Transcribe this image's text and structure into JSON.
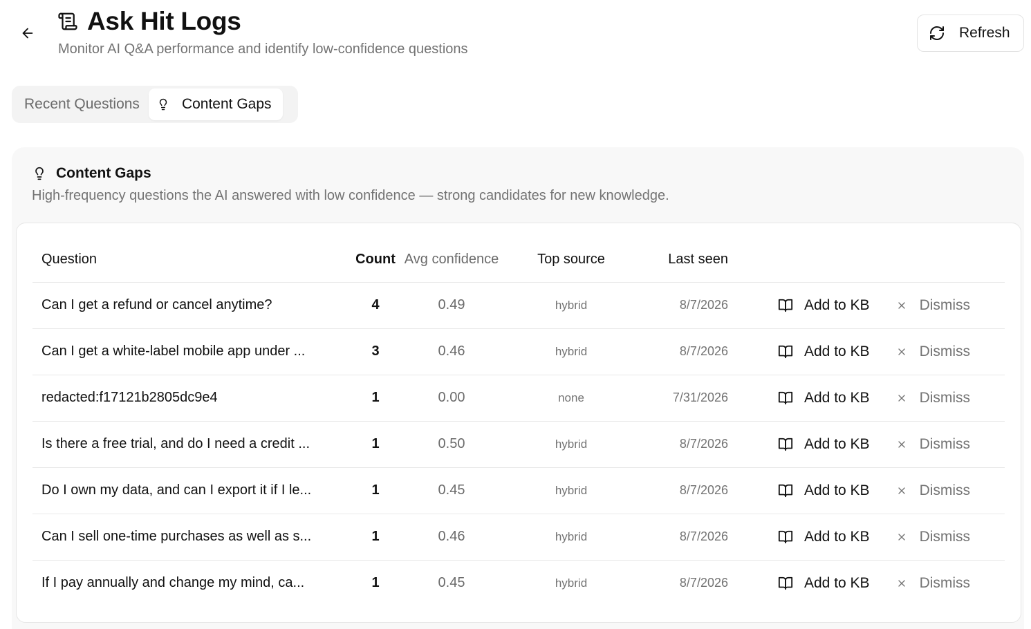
{
  "header": {
    "title": "Ask Hit Logs",
    "subtitle": "Monitor AI Q&A performance and identify low-confidence questions",
    "refresh_label": "Refresh"
  },
  "tabs": [
    {
      "label": "Recent Questions",
      "active": false
    },
    {
      "label": "Content Gaps",
      "active": true
    }
  ],
  "gaps": {
    "title": "Content Gaps",
    "description": "High-frequency questions the AI answered with low confidence — strong candidates for new knowledge.",
    "columns": {
      "question": "Question",
      "count": "Count",
      "avg_confidence": "Avg confidence",
      "top_source": "Top source",
      "last_seen": "Last seen"
    },
    "rows": [
      {
        "question": "Can I get a refund or cancel anytime?",
        "count": "4",
        "avg_confidence": "0.49",
        "top_source": "hybrid",
        "last_seen": "8/7/2026",
        "add_label": "Add to KB",
        "dismiss_label": "Dismiss"
      },
      {
        "question": "Can I get a white-label mobile app under ...",
        "count": "3",
        "avg_confidence": "0.46",
        "top_source": "hybrid",
        "last_seen": "8/7/2026",
        "add_label": "Add to KB",
        "dismiss_label": "Dismiss"
      },
      {
        "question": "redacted:f17121b2805dc9e4",
        "count": "1",
        "avg_confidence": "0.00",
        "top_source": "none",
        "last_seen": "7/31/2026",
        "add_label": "Add to KB",
        "dismiss_label": "Dismiss"
      },
      {
        "question": "Is there a free trial, and do I need a credit ...",
        "count": "1",
        "avg_confidence": "0.50",
        "top_source": "hybrid",
        "last_seen": "8/7/2026",
        "add_label": "Add to KB",
        "dismiss_label": "Dismiss"
      },
      {
        "question": "Do I own my data, and can I export it if I le...",
        "count": "1",
        "avg_confidence": "0.45",
        "top_source": "hybrid",
        "last_seen": "8/7/2026",
        "add_label": "Add to KB",
        "dismiss_label": "Dismiss"
      },
      {
        "question": "Can I sell one-time purchases as well as s...",
        "count": "1",
        "avg_confidence": "0.46",
        "top_source": "hybrid",
        "last_seen": "8/7/2026",
        "add_label": "Add to KB",
        "dismiss_label": "Dismiss"
      },
      {
        "question": "If I pay annually and change my mind, ca...",
        "count": "1",
        "avg_confidence": "0.45",
        "top_source": "hybrid",
        "last_seen": "8/7/2026",
        "add_label": "Add to KB",
        "dismiss_label": "Dismiss"
      }
    ]
  },
  "icons": {
    "back": "arrow-left-icon",
    "title": "scroll-text-icon",
    "refresh": "refresh-icon",
    "gaps": "lightbulb-icon",
    "add": "book-open-icon",
    "dismiss": "close-icon"
  },
  "colors": {
    "text": "#111111",
    "muted": "#737373",
    "tab_bg": "#f3f3f3",
    "card_bg": "#f8f8f8",
    "border": "#e6e6e6"
  }
}
